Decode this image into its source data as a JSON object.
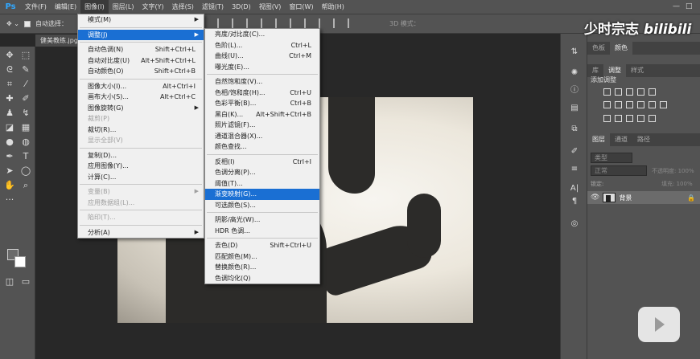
{
  "app": {
    "logo": "Ps"
  },
  "menubar": {
    "items": [
      "文件(F)",
      "编辑(E)",
      "图像(I)",
      "图层(L)",
      "文字(Y)",
      "选择(S)",
      "滤镜(T)",
      "3D(D)",
      "视图(V)",
      "窗口(W)",
      "帮助(H)"
    ]
  },
  "options": {
    "auto_select": "自动选择：",
    "mode_3d": "3D 模式："
  },
  "document": {
    "tab": "健美教练.jpg"
  },
  "image_menu": [
    {
      "label": "模式(M)",
      "arrow": true
    },
    {
      "sep": true
    },
    {
      "label": "调整(J)",
      "arrow": true,
      "highlight": true
    },
    {
      "sep": true
    },
    {
      "label": "自动色调(N)",
      "shortcut": "Shift+Ctrl+L"
    },
    {
      "label": "自动对比度(U)",
      "shortcut": "Alt+Shift+Ctrl+L"
    },
    {
      "label": "自动颜色(O)",
      "shortcut": "Shift+Ctrl+B"
    },
    {
      "sep": true
    },
    {
      "label": "图像大小(I)...",
      "shortcut": "Alt+Ctrl+I"
    },
    {
      "label": "画布大小(S)...",
      "shortcut": "Alt+Ctrl+C"
    },
    {
      "label": "图像旋转(G)",
      "arrow": true
    },
    {
      "label": "裁剪(P)",
      "disabled": true
    },
    {
      "label": "裁切(R)..."
    },
    {
      "label": "显示全部(V)",
      "disabled": true
    },
    {
      "sep": true
    },
    {
      "label": "复制(D)..."
    },
    {
      "label": "应用图像(Y)..."
    },
    {
      "label": "计算(C)..."
    },
    {
      "sep": true
    },
    {
      "label": "变量(B)",
      "arrow": true,
      "disabled": true
    },
    {
      "label": "应用数据组(L)...",
      "disabled": true
    },
    {
      "sep": true
    },
    {
      "label": "陷印(T)...",
      "disabled": true
    },
    {
      "sep": true
    },
    {
      "label": "分析(A)",
      "arrow": true
    }
  ],
  "adjust_menu": [
    {
      "label": "亮度/对比度(C)..."
    },
    {
      "label": "色阶(L)...",
      "shortcut": "Ctrl+L"
    },
    {
      "label": "曲线(U)...",
      "shortcut": "Ctrl+M"
    },
    {
      "label": "曝光度(E)..."
    },
    {
      "sep": true
    },
    {
      "label": "自然饱和度(V)..."
    },
    {
      "label": "色相/饱和度(H)...",
      "shortcut": "Ctrl+U"
    },
    {
      "label": "色彩平衡(B)...",
      "shortcut": "Ctrl+B"
    },
    {
      "label": "黑白(K)...",
      "shortcut": "Alt+Shift+Ctrl+B"
    },
    {
      "label": "照片滤镜(F)..."
    },
    {
      "label": "通道混合器(X)..."
    },
    {
      "label": "颜色查找..."
    },
    {
      "sep": true
    },
    {
      "label": "反相(I)",
      "shortcut": "Ctrl+I"
    },
    {
      "label": "色调分离(P)..."
    },
    {
      "label": "阈值(T)..."
    },
    {
      "label": "渐变映射(G)...",
      "highlight": true
    },
    {
      "label": "可选颜色(S)..."
    },
    {
      "sep": true
    },
    {
      "label": "阴影/高光(W)..."
    },
    {
      "label": "HDR 色调..."
    },
    {
      "sep": true
    },
    {
      "label": "去色(D)",
      "shortcut": "Shift+Ctrl+U"
    },
    {
      "label": "匹配颜色(M)..."
    },
    {
      "label": "替换颜色(R)..."
    },
    {
      "label": "色调均化(Q)"
    }
  ],
  "panels": {
    "top_tabs": [
      "色板",
      "颜色"
    ],
    "mid_tabs": [
      "库",
      "调整",
      "样式"
    ],
    "adj_title": "添加调整",
    "layer_tabs": [
      "图层",
      "通道",
      "路径"
    ],
    "layer_search": "类型",
    "blend_mode": "正常",
    "opacity_label": "不透明度: 100%",
    "lock_label": "锁定:",
    "fill_label": "填充: 100%",
    "layer_name": "背景"
  },
  "watermark": {
    "text": "少时宗志",
    "brand": "bilibili"
  },
  "colors": {
    "highlight": "#1a6fd3",
    "ps_blue": "#31a8ff",
    "menu_bg": "#f0f0f0"
  }
}
